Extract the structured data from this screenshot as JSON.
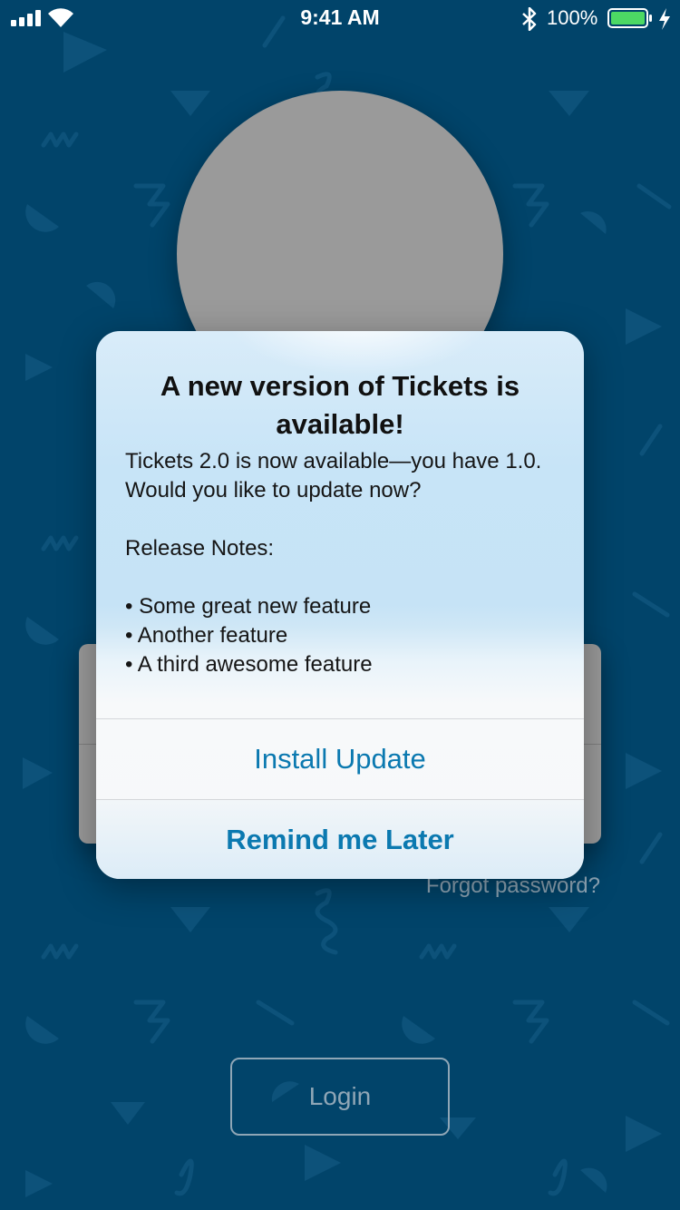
{
  "status_bar": {
    "time": "9:41 AM",
    "battery_percent": "100%",
    "battery_level": 1.0,
    "battery_color": "#4cd964",
    "icons": [
      "signal-icon",
      "wifi-icon",
      "bluetooth-icon",
      "battery-icon",
      "charging-icon"
    ]
  },
  "login": {
    "forgot_password": "Forgot password?",
    "login_button": "Login",
    "background_color": "#01446a"
  },
  "alert": {
    "title": "A new version of Tickets is available!",
    "message": "Tickets 2.0 is now available—you have 1.0. Would you like to update now?\n\nRelease Notes:\n\n• Some great new feature\n• Another feature\n• A third awesome feature",
    "buttons": {
      "install": "Install Update",
      "remind": "Remind me Later"
    },
    "button_color": "#0b79b0"
  }
}
